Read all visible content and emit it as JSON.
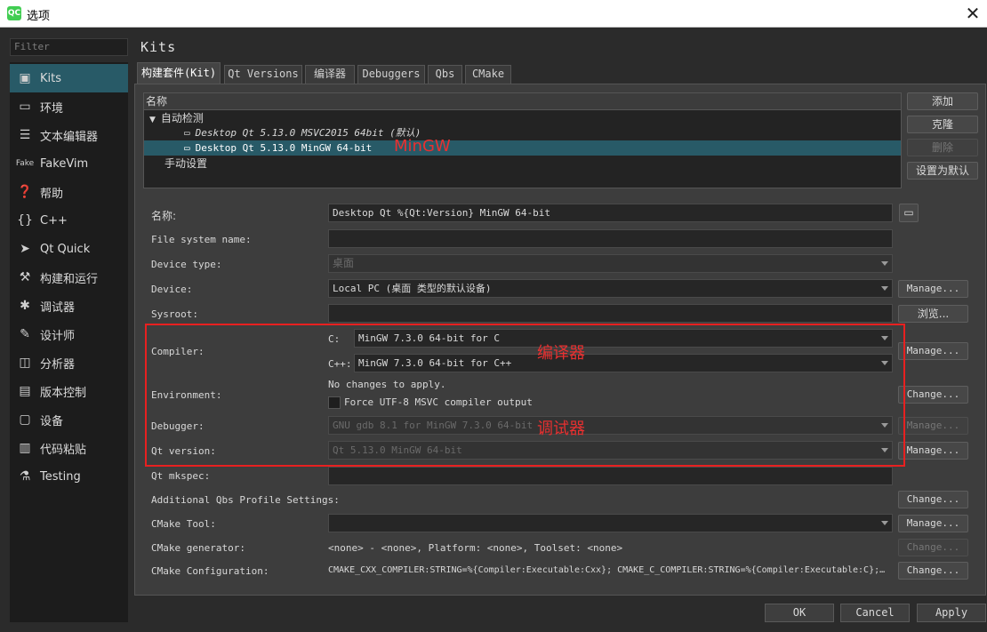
{
  "window": {
    "app_icon": "QC",
    "title": "选项",
    "close": "✕"
  },
  "filter_placeholder": "Filter",
  "sidebar": [
    {
      "label": "Kits",
      "icon": "kits-icon"
    },
    {
      "label": "环境",
      "icon": "monitor-icon"
    },
    {
      "label": "文本编辑器",
      "icon": "document-icon"
    },
    {
      "label": "FakeVim",
      "icon": "fakevim-icon"
    },
    {
      "label": "帮助",
      "icon": "help-icon"
    },
    {
      "label": "C++",
      "icon": "braces-icon"
    },
    {
      "label": "Qt Quick",
      "icon": "qtquick-icon"
    },
    {
      "label": "构建和运行",
      "icon": "hammer-icon"
    },
    {
      "label": "调试器",
      "icon": "bug-icon"
    },
    {
      "label": "设计师",
      "icon": "pencil-icon"
    },
    {
      "label": "分析器",
      "icon": "analyzer-icon"
    },
    {
      "label": "版本控制",
      "icon": "version-control-icon"
    },
    {
      "label": "设备",
      "icon": "device-icon"
    },
    {
      "label": "代码粘贴",
      "icon": "paste-icon"
    },
    {
      "label": "Testing",
      "icon": "testing-icon"
    }
  ],
  "page_title": "Kits",
  "tabs": [
    "构建套件(Kit)",
    "Qt Versions",
    "编译器",
    "Debuggers",
    "Qbs",
    "CMake"
  ],
  "tree": {
    "header": "名称",
    "auto_group": "自动检测",
    "kit1": "Desktop Qt 5.13.0 MSVC2015 64bit (默认)",
    "kit2": "Desktop Qt 5.13.0 MinGW 64-bit",
    "manual_group": "手动设置"
  },
  "kit_buttons": {
    "add": "添加",
    "clone": "克隆",
    "remove": "删除",
    "default": "设置为默认"
  },
  "form": {
    "name_label": "名称:",
    "name_value": "Desktop Qt %{Qt:Version} MinGW 64-bit",
    "fs_label": "File system name:",
    "fs_value": "",
    "device_type_label": "Device type:",
    "device_type_value": "桌面",
    "device_label": "Device:",
    "device_value": "Local PC (桌面 类型的默认设备)",
    "sysroot_label": "Sysroot:",
    "sysroot_value": "",
    "compiler_label": "Compiler:",
    "c_label": "C:",
    "c_value": "MinGW 7.3.0 64-bit for C",
    "cpp_label": "C++:",
    "cpp_value": "MinGW 7.3.0 64-bit for C++",
    "env_label": "Environment:",
    "env_status": "No changes to apply.",
    "env_checkbox": "Force UTF-8 MSVC compiler output",
    "debugger_label": "Debugger:",
    "debugger_value": "GNU gdb 8.1 for MinGW 7.3.0 64-bit",
    "qtversion_label": "Qt version:",
    "qtversion_value": "Qt 5.13.0 MinGW 64-bit",
    "mkspec_label": "Qt mkspec:",
    "mkspec_value": "",
    "qbs_label": "Additional Qbs Profile Settings:",
    "cmake_tool_label": "CMake Tool:",
    "cmake_tool_value": "",
    "cmake_gen_label": "CMake generator:",
    "cmake_gen_value": "<none> - <none>, Platform: <none>, Toolset: <none>",
    "cmake_conf_label": "CMake Configuration:",
    "cmake_conf_value": "CMAKE_CXX_COMPILER:STRING=%{Compiler:Executable:Cxx}; CMAKE_C_COMPILER:STRING=%{Compiler:Executable:C};…"
  },
  "side_buttons": {
    "manage": "Manage...",
    "browse": "浏览...",
    "change": "Change..."
  },
  "annotations": {
    "mingw": "MinGW",
    "compiler": "编译器",
    "debugger": "调试器"
  },
  "dialog_buttons": {
    "ok": "OK",
    "cancel": "Cancel",
    "apply": "Apply"
  }
}
